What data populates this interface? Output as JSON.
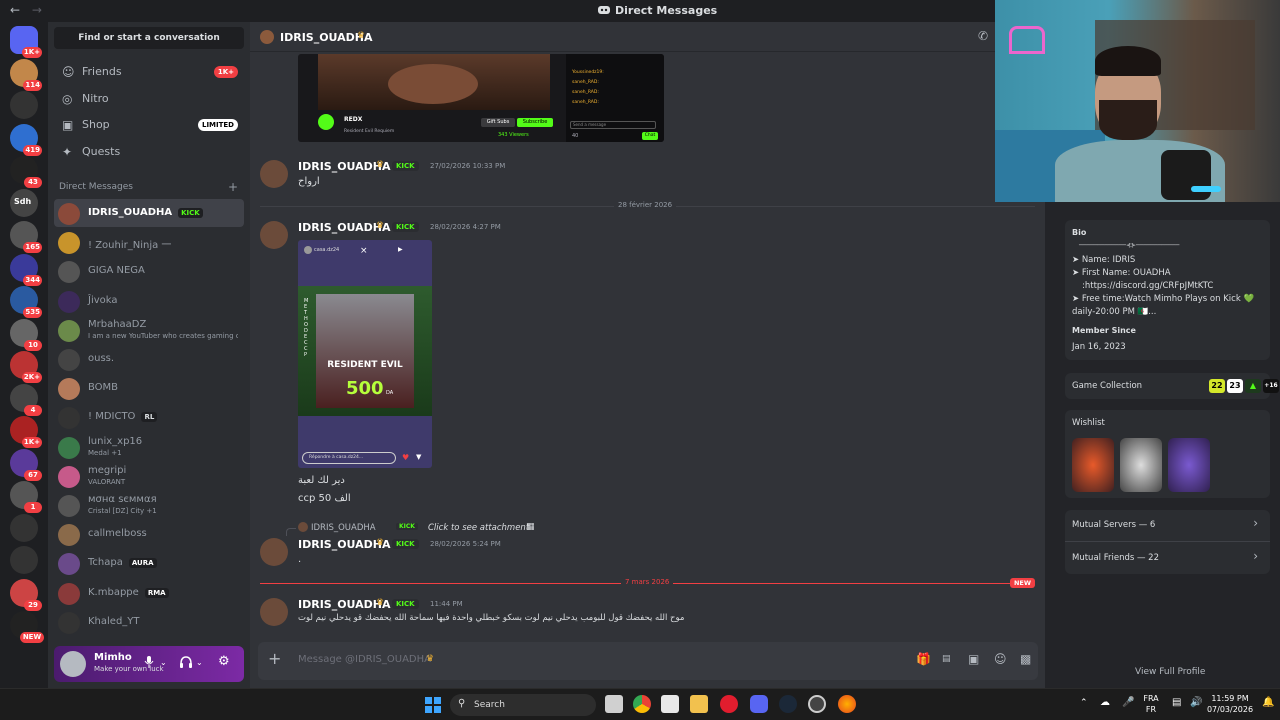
{
  "window": {
    "title": "Direct Messages",
    "back": "←",
    "forward": "→"
  },
  "servers": {
    "badges": [
      "1K+",
      "114",
      "",
      "419",
      "43",
      "",
      "165",
      "344",
      "535",
      "10",
      "2K+",
      "4",
      "1K+",
      "67",
      "1",
      "",
      "",
      "29",
      "NEW"
    ],
    "extra_label": "Sdh"
  },
  "sidebar": {
    "find_placeholder": "Find or start a conversation",
    "nav": [
      {
        "label": "Friends",
        "icon": "friends-icon",
        "pill": "1K+"
      },
      {
        "label": "Nitro",
        "icon": "nitro-icon",
        "pill": ""
      },
      {
        "label": "Shop",
        "icon": "shop-icon",
        "pill": "LIMITED"
      },
      {
        "label": "Quests",
        "icon": "quests-icon",
        "pill": ""
      }
    ],
    "dm_header": "Direct Messages",
    "dm_plus": "+",
    "dms": [
      {
        "name": "IDRIS_OUADHA",
        "tag": "KICK",
        "sub": "",
        "active": true,
        "color": "#8b4a3a"
      },
      {
        "name": "! Zouhir_Ninja ⼀",
        "sub": "",
        "color": "#c8942b"
      },
      {
        "name": "GIGA NEGA",
        "sub": "",
        "color": "#555"
      },
      {
        "name": "Ĵivoka",
        "sub": "",
        "color": "#3c2a5a"
      },
      {
        "name": "MrbahaaDZ",
        "sub": "I am a new YouTuber who creates gaming c...",
        "color": "#6b8a4a"
      },
      {
        "name": "ouss.",
        "sub": "",
        "color": "#444"
      },
      {
        "name": "BOMB",
        "sub": "",
        "color": "#b57a5a"
      },
      {
        "name": "! MDICTO",
        "tag": "RL",
        "sub": "",
        "color": "#333"
      },
      {
        "name": "lunix_xp16",
        "sub": "Medal +1",
        "color": "#3a7a4a"
      },
      {
        "name": "megripi",
        "sub": "VALORANT",
        "color": "#c65a8a"
      },
      {
        "name": "мσнα sєммαя",
        "sub": "Cristal [DZ] City +1",
        "color": "#555"
      },
      {
        "name": "callmelboss",
        "sub": "",
        "color": "#8a6a4a"
      },
      {
        "name": "Tchapa",
        "tag": "AURA",
        "sub": "",
        "color": "#6a4a8a"
      },
      {
        "name": "K.mbappe",
        "tag": "RMA",
        "sub": "",
        "color": "#8a3a3a"
      },
      {
        "name": "Khaled_YT",
        "sub": "",
        "color": "#333"
      }
    ]
  },
  "user": {
    "name": "Mimho",
    "status": "Make your own luck"
  },
  "chat": {
    "recipient": "IDRIS_OUADHA",
    "kick_label": "KICK",
    "messages": [
      {
        "author": "IDRIS_OUADHA",
        "time": "27/02/2026 10:33 PM",
        "text": "ارواح"
      },
      {
        "author": "IDRIS_OUADHA",
        "time": "28/02/2026 4:27 PM",
        "caption1": "دير لك لعبة",
        "caption2": "ccp 50 الف"
      },
      {
        "author": "IDRIS_OUADHA",
        "time": "28/02/2026 5:24 PM",
        "reply_author": "IDRIS_OUADHA",
        "reply_text": "Click to see attachment",
        "text": "."
      },
      {
        "author": "IDRIS_OUADHA",
        "time": "11:44 PM",
        "text": "موح الله يحفضك قول للبومب يدحلي نيم لوت بسكو خبطلي واحدة فيها سماحة الله يحفضك قو يدحلي نيم لوت"
      }
    ],
    "dividers": [
      {
        "label": "28 février 2026",
        "new": false
      },
      {
        "label": "7 mars 2026",
        "new": true,
        "new_label": "NEW"
      }
    ],
    "composer_placeholder": "Message @IDRIS_OUADHA",
    "stream_preview": {
      "streamer": "REDX",
      "game": "Resident Evil Requiem",
      "viewers": "343 Viewers",
      "gift": "Gift Subs",
      "subscribe": "Subscribe",
      "chat_placeholder": "Send a message",
      "chat_lines": [
        "Youssinedz19:",
        "saneh_RAD:",
        "saneh_RAD:",
        "saneh_RAD:"
      ],
      "chat_count": "40",
      "chat_button": "Chat"
    },
    "story_preview": {
      "user": "casa.dz24",
      "game_title": "RESIDENT EVIL",
      "price": "500",
      "currency": "DA",
      "side_text": "METHODE CCP",
      "reply_placeholder": "Répondre à casa.dz24..."
    }
  },
  "profile": {
    "bio_header": "Bio",
    "bio_lines": [
      "─────────────⊰⊱────────────",
      "➤ Name: IDRIS",
      "➤ First Name: OUADHA",
      ":https://discord.gg/CRFpJMtKTC",
      "➤ Free time:Watch Mimho Plays on Kick 💚",
      "daily-20:00 PM 🇩🇿..."
    ],
    "member_since_header": "Member Since",
    "member_since": "Jan 16, 2023",
    "game_collection": "Game Collection",
    "games": [
      "22",
      "23",
      "+16"
    ],
    "wishlist": "Wishlist",
    "mutual_servers": "Mutual Servers — 6",
    "mutual_friends": "Mutual Friends — 22",
    "view_full": "View Full Profile"
  },
  "taskbar": {
    "search": "Search",
    "lang_top": "FRA",
    "lang_bottom": "FR",
    "time": "11:59 PM",
    "date": "07/03/2026"
  },
  "colors": {
    "accent": "#5865f2",
    "kick": "#53fc18",
    "danger": "#f23f43",
    "link": "#00a8fc"
  }
}
